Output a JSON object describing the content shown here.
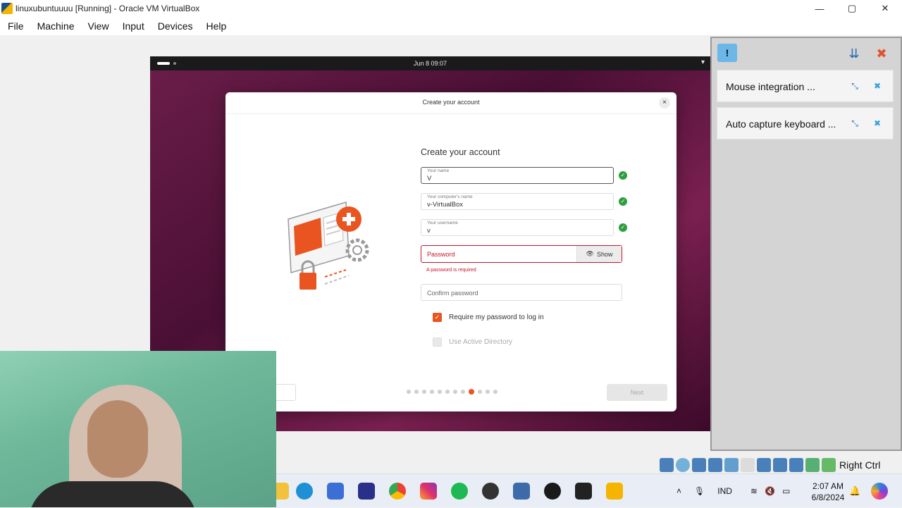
{
  "window": {
    "title": "linuxubuntuuuu [Running] - Oracle VM VirtualBox",
    "controls": {
      "minimize": "—",
      "maximize": "▢",
      "close": "✕"
    }
  },
  "menu": [
    "File",
    "Machine",
    "View",
    "Input",
    "Devices",
    "Help"
  ],
  "guest": {
    "clock": "Jun 8  09:07",
    "tray_icon": "▾",
    "dialog": {
      "title": "Create your account",
      "close": "×",
      "heading": "Create your account",
      "fields": [
        {
          "label": "Your name",
          "value": "V"
        },
        {
          "label": "Your computer's name",
          "value": "v-VirtualBox"
        },
        {
          "label": "Your username",
          "value": "v"
        }
      ],
      "password": {
        "placeholder": "Password",
        "show_label": "Show",
        "error": "A password is required"
      },
      "confirm_placeholder": "Confirm password",
      "require_password": {
        "label": "Require my password to log in",
        "checked": true
      },
      "active_directory": {
        "label": "Use Active Directory",
        "checked": false
      },
      "steps": {
        "total": 12,
        "current": 9
      },
      "next_label": "Next",
      "accent": "#e95420"
    }
  },
  "side_panel": {
    "notices": [
      {
        "text": "Mouse integration ..."
      },
      {
        "text": "Auto capture keyboard ..."
      }
    ]
  },
  "statusbar": {
    "host_key": "Right Ctrl"
  },
  "taskbar": {
    "language": "IND",
    "time": "2:07 AM",
    "date": "6/8/2024"
  }
}
